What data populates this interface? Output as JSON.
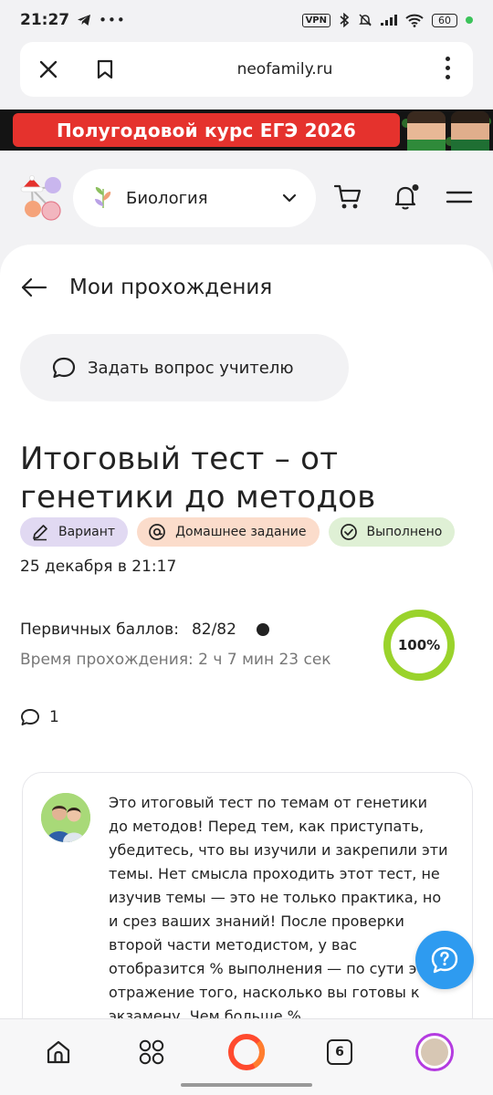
{
  "status_bar": {
    "time": "21:27",
    "vpn_label": "VPN",
    "battery_level": "60"
  },
  "browser": {
    "url": "neofamily.ru"
  },
  "banner": {
    "text": "Полугодовой курс ЕГЭ 2026"
  },
  "header": {
    "subject": "Биология"
  },
  "page": {
    "back_title": "Мои прохождения",
    "ask_button": "Задать вопрос учителю",
    "test_title": "Итоговый тест – от генетики до методов",
    "chips": [
      {
        "label": "Вариант",
        "icon": "pencil-icon",
        "color": "#e1d9f2"
      },
      {
        "label": "Домашнее задание",
        "icon": "at-icon",
        "color": "#fbdccb"
      },
      {
        "label": "Выполнено",
        "icon": "check-circle-icon",
        "color": "#dff0d5"
      }
    ],
    "date": "25 декабря в 21:17",
    "primary_score_label": "Первичных баллов:",
    "primary_score_value": "82/82",
    "duration": "Время прохождения: 2 ч 7 мин 23 сек",
    "progress_percent": "100%",
    "progress_fraction": 1.0,
    "progress_color": "#9ad32b",
    "comments_count": "1",
    "description": "Это итоговый тест по темам от генетики до методов! Перед тем, как приступать, убедитесь, что вы изучили и закрепили эти темы. Нет смысла проходить этот тест, не изучив темы — это не только практика, но и срез ваших знаний! После проверки второй части методистом, у вас отобразится % выполнения — по сути это отражение того, насколько вы готовы к экзамену. Чем больше %"
  },
  "bottom_nav": {
    "tabs_count": "6"
  },
  "colors": {
    "accent_ring": "#9ad32b",
    "help_button": "#2e9bf0",
    "banner_red": "#e5322d",
    "alice_orange": "#ff4a2e"
  }
}
